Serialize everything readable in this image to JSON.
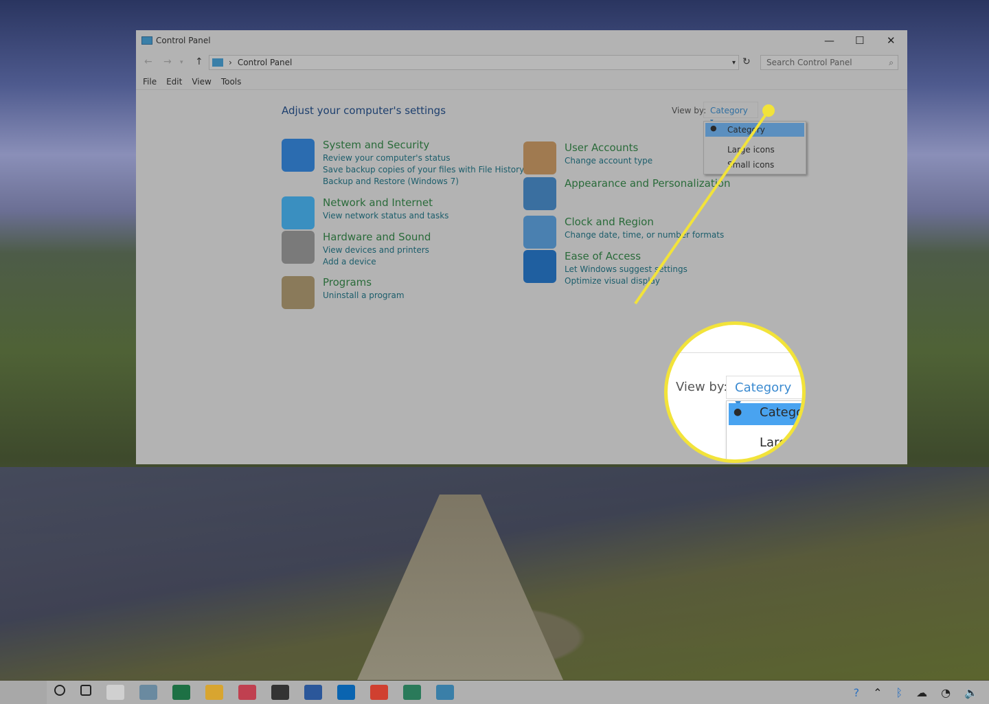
{
  "window": {
    "title": "Control Panel",
    "minimize": "—",
    "maximize": "☐",
    "close": "✕"
  },
  "address": {
    "path": "Control Panel",
    "search_placeholder": "Search Control Panel"
  },
  "menu": [
    "File",
    "Edit",
    "View",
    "Tools"
  ],
  "heading": "Adjust your computer's settings",
  "view_by": {
    "label": "View by:",
    "selected": "Category",
    "options": [
      "Category",
      "Large icons",
      "Small icons"
    ]
  },
  "categories_left": [
    {
      "title": "System and Security",
      "links": [
        "Review your computer's status",
        "Save backup copies of your files with File History",
        "Backup and Restore (Windows 7)"
      ],
      "icon": "shield-icon",
      "color": "#2b6cb0"
    },
    {
      "title": "Network and Internet",
      "links": [
        "View network status and tasks"
      ],
      "icon": "network-globe-icon",
      "color": "#3a8fc0"
    },
    {
      "title": "Hardware and Sound",
      "links": [
        "View devices and printers",
        "Add a device"
      ],
      "icon": "printer-icon",
      "color": "#7a7a7a"
    },
    {
      "title": "Programs",
      "links": [
        "Uninstall a program"
      ],
      "icon": "programs-disc-icon",
      "color": "#8a7a5a"
    }
  ],
  "categories_right": [
    {
      "title": "User Accounts",
      "links": [
        "Change account type"
      ],
      "icon": "users-icon",
      "color": "#a07a50"
    },
    {
      "title": "Appearance and Personalization",
      "links": [],
      "icon": "monitor-palette-icon",
      "color": "#3a6fa0"
    },
    {
      "title": "Clock and Region",
      "links": [
        "Change date, time, or number formats"
      ],
      "icon": "clock-globe-icon",
      "color": "#4a80b0"
    },
    {
      "title": "Ease of Access",
      "links": [
        "Let Windows suggest settings",
        "Optimize visual display"
      ],
      "icon": "ease-of-access-icon",
      "color": "#1f5fa0"
    }
  ],
  "magnifier": {
    "label": "View by:",
    "selected": "Category",
    "item1": "Catego",
    "item2": "Larg"
  },
  "colors": {
    "highlight": "#f2e33a",
    "dropdown_selected": "#5b8fbf"
  },
  "taskbar": [
    "cortana-icon",
    "task-view-icon",
    "amazon-icon",
    "notepad-icon",
    "excel-icon",
    "file-explorer-icon",
    "snipping-icon",
    "photos-icon",
    "word-icon",
    "outlook-icon",
    "chrome-icon",
    "defender-icon",
    "control-panel-icon"
  ],
  "tray": [
    "help-icon",
    "chevron-up-icon",
    "bluetooth-icon",
    "onedrive-icon",
    "wifi-icon",
    "volume-icon"
  ]
}
